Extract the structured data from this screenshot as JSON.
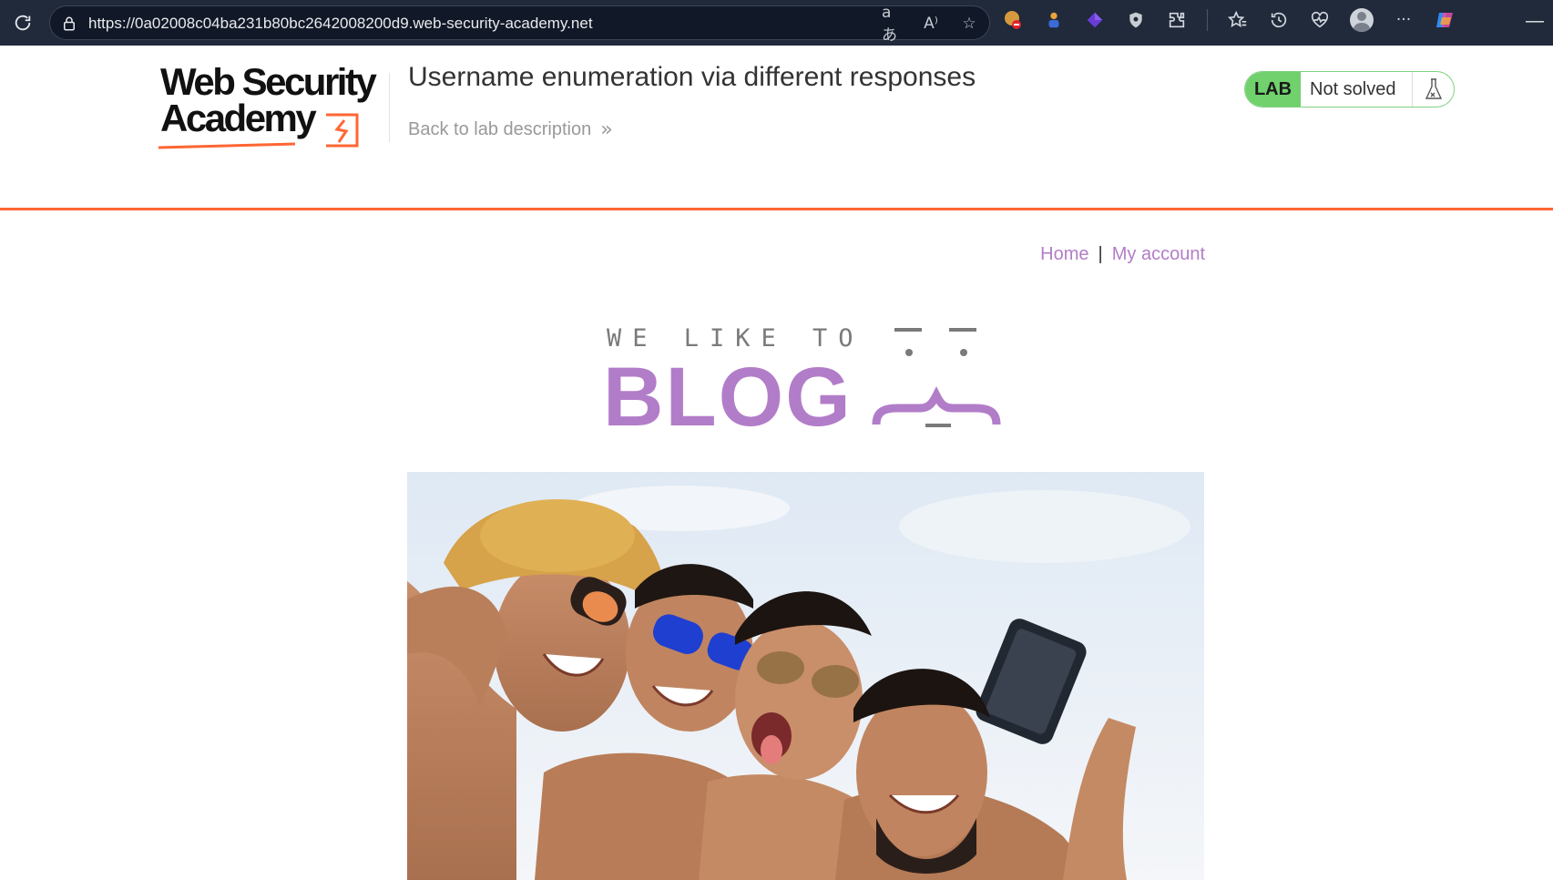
{
  "browser": {
    "url": "https://0a02008c04ba231b80bc2642008200d9.web-security-academy.net",
    "icons": [
      "reload-icon",
      "lock-icon",
      "translate-icon",
      "read-aloud-icon",
      "favorite-star-icon",
      "extension-icons",
      "extensions-icon",
      "favorites-icon",
      "history-icon",
      "health-icon",
      "profile-icon",
      "more-icon",
      "copilot-icon",
      "minimize-icon"
    ]
  },
  "lab": {
    "logo_line1": "Web Security",
    "logo_line2": "Academy",
    "title": "Username enumeration via different responses",
    "back_link": "Back to lab description",
    "badge": "LAB",
    "status": "Not solved",
    "accent_color": "#ff6633",
    "status_color": "#70d16d"
  },
  "nav": {
    "home": "Home",
    "separator": "|",
    "my_account": "My account"
  },
  "blog_logo": {
    "tagline": "WE LIKE TO",
    "word": "BLOG",
    "color": "#b27dc8"
  },
  "hero": {
    "description": "group-selfie-photo"
  }
}
